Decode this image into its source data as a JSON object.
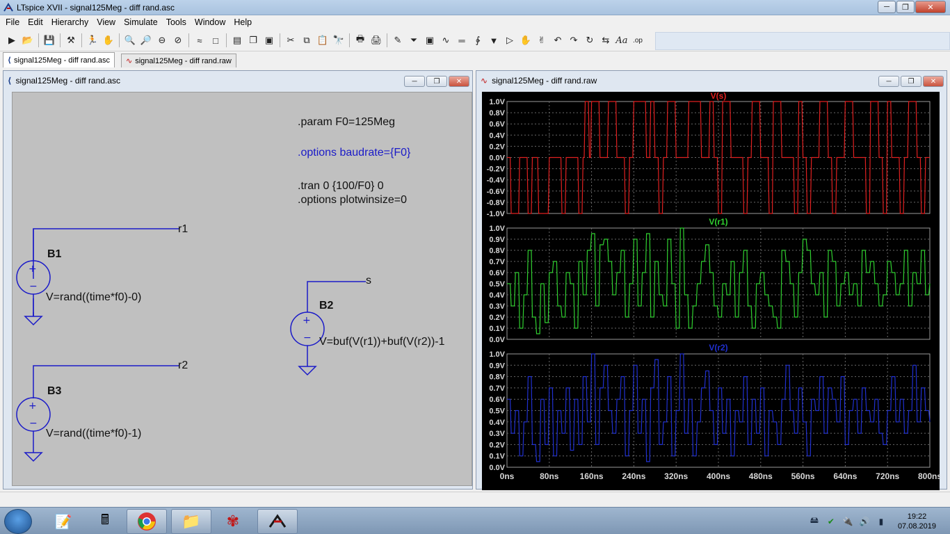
{
  "window": {
    "title": "LTspice XVII - signal125Meg - diff rand.asc"
  },
  "menu": [
    "File",
    "Edit",
    "Hierarchy",
    "View",
    "Simulate",
    "Tools",
    "Window",
    "Help"
  ],
  "tabs": [
    {
      "label": "signal125Meg - diff rand.asc"
    },
    {
      "label": "signal125Meg - diff rand.raw"
    }
  ],
  "schematic_window": {
    "title": "signal125Meg - diff rand.asc",
    "directives": {
      "param": ".param F0=125Meg",
      "options_baud": ".options baudrate={F0}",
      "tran": ".tran 0 {100/F0} 0",
      "options_plot": ".options plotwinsize=0"
    },
    "components": [
      {
        "name": "B1",
        "value": "V=rand((time*f0)-0)",
        "net": "r1"
      },
      {
        "name": "B3",
        "value": "V=rand((time*f0)-1)",
        "net": "r2"
      },
      {
        "name": "B2",
        "value": "V=buf(V(r1))+buf(V(r2))-1",
        "net": "s"
      }
    ]
  },
  "waveform_window": {
    "title": "signal125Meg - diff rand.raw"
  },
  "chart_data": [
    {
      "type": "line",
      "title": "V(s)",
      "color": "#e02020",
      "ylim": [
        -1.0,
        1.0
      ],
      "yticks": [
        "1.0V",
        "0.8V",
        "0.6V",
        "0.4V",
        "0.2V",
        "0.0V",
        "-0.2V",
        "-0.4V",
        "-0.6V",
        "-0.8V",
        "-1.0V"
      ],
      "xlim": [
        0,
        800
      ],
      "grid": true,
      "x": [
        0,
        4,
        8,
        16,
        24,
        28,
        32,
        40,
        44,
        48,
        52,
        56,
        60,
        68,
        76,
        80,
        84,
        88,
        96,
        104,
        112,
        120,
        128,
        136,
        144,
        148,
        152,
        156,
        160,
        168,
        176,
        184,
        192,
        200,
        208,
        216,
        224,
        232,
        240,
        248,
        256,
        264,
        272,
        280,
        288,
        296,
        304,
        312,
        320,
        328,
        336,
        344,
        352,
        360,
        368,
        376,
        384,
        392,
        400,
        408,
        416,
        424,
        432,
        440,
        448,
        456,
        464,
        472,
        480,
        488,
        496,
        504,
        512,
        520,
        528,
        536,
        544,
        552,
        560,
        568,
        576,
        584,
        592,
        600,
        608,
        616,
        624,
        632,
        640,
        648,
        656,
        664,
        672,
        680,
        688,
        696,
        704,
        712,
        720,
        728,
        736,
        744,
        752,
        760,
        768,
        776,
        784,
        792,
        800
      ],
      "y": [
        0,
        0,
        -1,
        -1,
        0,
        0,
        0,
        -1,
        -1,
        0,
        0,
        0,
        -1,
        -1,
        -1,
        0,
        0,
        0,
        0,
        -1,
        0,
        0,
        0,
        -1,
        0,
        1,
        1,
        0,
        1,
        1,
        0,
        0,
        1,
        1,
        0,
        0,
        -1,
        0,
        1,
        1,
        1,
        0,
        1,
        0,
        -1,
        0,
        1,
        1,
        0,
        0,
        0,
        1,
        1,
        1,
        0,
        0,
        1,
        0,
        -1,
        1,
        1,
        0,
        0,
        0,
        -1,
        0,
        1,
        1,
        0,
        0,
        -1,
        1,
        1,
        0,
        0,
        0,
        -1,
        1,
        0,
        -1,
        0,
        0,
        1,
        1,
        0,
        -1,
        0,
        0,
        1,
        1,
        0,
        0,
        0,
        -1,
        1,
        1,
        0,
        -1,
        1,
        0,
        0,
        -1,
        0,
        1,
        1,
        0,
        -1,
        0,
        0,
        -1,
        0
      ]
    },
    {
      "type": "line",
      "title": "V(r1)",
      "color": "#30d030",
      "ylim": [
        0.0,
        1.0
      ],
      "yticks": [
        "1.0V",
        "0.9V",
        "0.8V",
        "0.7V",
        "0.6V",
        "0.5V",
        "0.4V",
        "0.3V",
        "0.2V",
        "0.1V",
        "0.0V"
      ],
      "xlim": [
        0,
        800
      ],
      "grid": true,
      "x": [
        0,
        8,
        16,
        24,
        32,
        40,
        48,
        56,
        64,
        72,
        80,
        88,
        96,
        104,
        112,
        120,
        128,
        136,
        144,
        152,
        160,
        168,
        176,
        184,
        192,
        200,
        208,
        216,
        224,
        232,
        240,
        248,
        256,
        264,
        272,
        280,
        288,
        296,
        304,
        312,
        320,
        328,
        336,
        344,
        352,
        360,
        368,
        376,
        384,
        392,
        400,
        408,
        416,
        424,
        432,
        440,
        448,
        456,
        464,
        472,
        480,
        488,
        496,
        504,
        512,
        520,
        528,
        536,
        544,
        552,
        560,
        568,
        576,
        584,
        592,
        600,
        608,
        616,
        624,
        632,
        640,
        648,
        656,
        664,
        672,
        680,
        688,
        696,
        704,
        712,
        720,
        728,
        736,
        744,
        752,
        760,
        768,
        776,
        784,
        792,
        800
      ],
      "y": [
        0.5,
        0.3,
        0.6,
        0.1,
        0.4,
        0.8,
        0.2,
        0.05,
        0.5,
        0.15,
        0.6,
        0.7,
        0.3,
        0.2,
        0.6,
        0.5,
        0.1,
        0.7,
        0.4,
        0.8,
        0.95,
        0.3,
        0.85,
        0.9,
        0.7,
        0.4,
        0.6,
        0.8,
        0.2,
        0.5,
        0.9,
        0.3,
        0.6,
        0.95,
        0.2,
        0.7,
        0.4,
        0.3,
        0.9,
        0.5,
        0.1,
        1.0,
        0.4,
        0.1,
        0.3,
        0.5,
        0.7,
        0.85,
        0.6,
        0.3,
        0.2,
        0.5,
        0.4,
        0.7,
        0.2,
        0.6,
        0.8,
        0.3,
        0.1,
        0.5,
        0.6,
        0.4,
        0.3,
        0.2,
        0.1,
        0.8,
        0.7,
        0.5,
        0.2,
        0.6,
        0.9,
        0.8,
        0.5,
        0.4,
        0.6,
        0.2,
        0.8,
        0.7,
        0.3,
        0.5,
        0.6,
        0.4,
        0.5,
        0.3,
        0.8,
        0.6,
        0.7,
        0.5,
        0.3,
        0.4,
        0.7,
        0.6,
        0.4,
        0.5,
        0.8,
        0.3,
        0.6,
        0.5,
        0.8,
        0.4,
        0.5
      ]
    },
    {
      "type": "line",
      "title": "V(r2)",
      "color": "#2030d0",
      "ylim": [
        0.0,
        1.0
      ],
      "yticks": [
        "1.0V",
        "0.9V",
        "0.8V",
        "0.7V",
        "0.6V",
        "0.5V",
        "0.4V",
        "0.3V",
        "0.2V",
        "0.1V",
        "0.0V"
      ],
      "xticks": [
        "0ns",
        "80ns",
        "160ns",
        "240ns",
        "320ns",
        "400ns",
        "480ns",
        "560ns",
        "640ns",
        "720ns",
        "800ns"
      ],
      "xlim": [
        0,
        800
      ],
      "grid": true,
      "x": [
        0,
        8,
        16,
        24,
        32,
        40,
        48,
        56,
        64,
        72,
        80,
        88,
        96,
        104,
        112,
        120,
        128,
        136,
        144,
        152,
        160,
        168,
        176,
        184,
        192,
        200,
        208,
        216,
        224,
        232,
        240,
        248,
        256,
        264,
        272,
        280,
        288,
        296,
        304,
        312,
        320,
        328,
        336,
        344,
        352,
        360,
        368,
        376,
        384,
        392,
        400,
        408,
        416,
        424,
        432,
        440,
        448,
        456,
        464,
        472,
        480,
        488,
        496,
        504,
        512,
        520,
        528,
        536,
        544,
        552,
        560,
        568,
        576,
        584,
        592,
        600,
        608,
        616,
        624,
        632,
        640,
        648,
        656,
        664,
        672,
        680,
        688,
        696,
        704,
        712,
        720,
        728,
        736,
        744,
        752,
        760,
        768,
        776,
        784,
        792,
        800
      ],
      "y": [
        0.6,
        0.3,
        0.5,
        0.1,
        0.4,
        0.8,
        0.2,
        0.05,
        0.6,
        0.2,
        0.7,
        0.1,
        0.5,
        0.3,
        0.7,
        0.15,
        0.6,
        0.2,
        0.8,
        0.4,
        1.0,
        0.2,
        0.7,
        0.9,
        0.5,
        0.3,
        0.6,
        0.8,
        0.1,
        0.5,
        0.9,
        0.3,
        0.6,
        0.05,
        0.7,
        0.95,
        0.2,
        0.4,
        0.8,
        0.1,
        0.5,
        1.0,
        0.3,
        0.6,
        0.1,
        0.4,
        0.7,
        0.85,
        0.5,
        0.2,
        0.7,
        0.3,
        0.6,
        0.1,
        0.5,
        0.4,
        0.8,
        0.2,
        0.6,
        0.3,
        0.7,
        0.1,
        0.5,
        0.4,
        0.2,
        0.6,
        0.9,
        0.5,
        0.3,
        0.7,
        0.4,
        0.1,
        0.6,
        0.5,
        0.8,
        0.3,
        0.7,
        0.6,
        0.4,
        0.8,
        0.2,
        0.5,
        0.6,
        0.3,
        0.7,
        0.5,
        0.4,
        0.6,
        0.3,
        0.2,
        0.5,
        0.8,
        0.4,
        0.6,
        0.3,
        0.5,
        0.9,
        0.4,
        0.7,
        0.5,
        0.4
      ]
    }
  ],
  "taskbar": {
    "time": "19:22",
    "date": "07.08.2019"
  }
}
